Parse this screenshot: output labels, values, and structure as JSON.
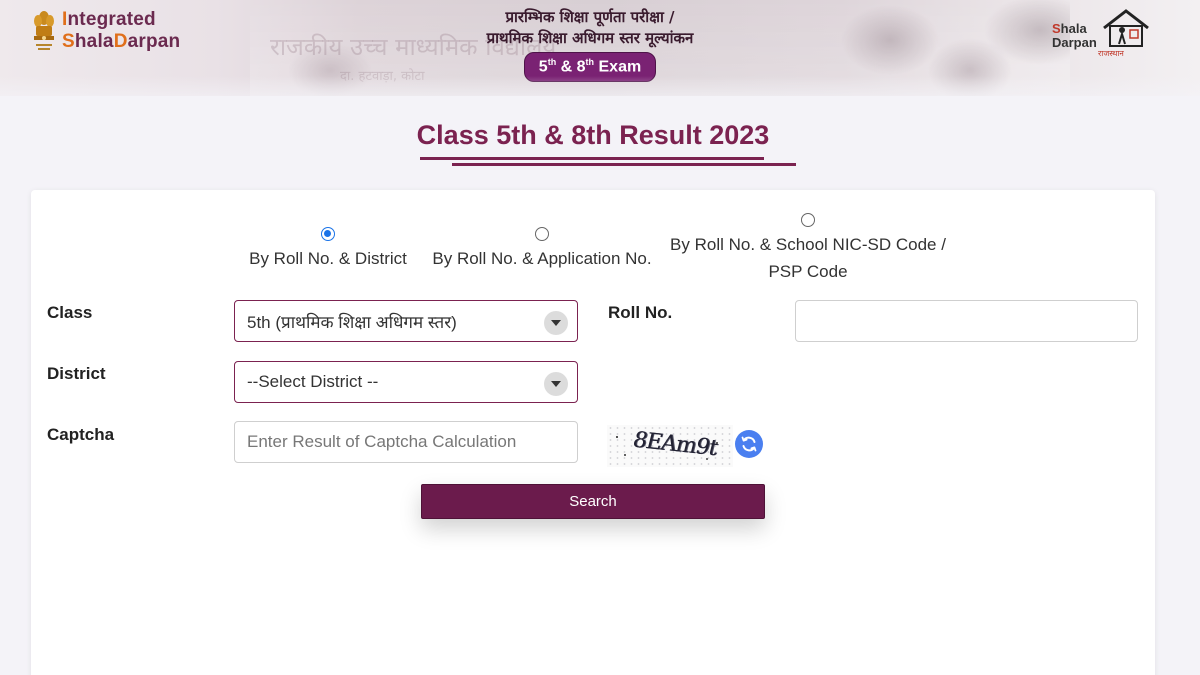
{
  "header": {
    "logo_left": {
      "line1_accent": "I",
      "line1_rest": "ntegrated",
      "line2_accent": "S",
      "line2_mid": "hala",
      "line2_accent2": "D",
      "line2_rest": "arpan"
    },
    "hindi_line1": "प्रारम्भिक शिक्षा पूर्णता परीक्षा /",
    "hindi_line2": "प्राथमिक शिक्षा अधिगम स्तर मूल्यांकन",
    "exam_pill": {
      "n1": "5",
      "sup1": "th",
      "mid": " & 8",
      "sup2": "th",
      "rest": " Exam"
    },
    "logo_right": {
      "line1_accent": "S",
      "line1_rest": "hala",
      "line2": "Darpan",
      "tag": "राजस्थान"
    },
    "background_ghost_text": "राजकीय उच्च माध्यमिक विद्यालय",
    "background_ghost_text2": "दा. हटवाड़ा, कोटा"
  },
  "heading": "Class 5th & 8th Result 2023",
  "search_modes": [
    {
      "label": "By Roll No. & District",
      "selected": true
    },
    {
      "label": "By Roll No. & Application No.",
      "selected": false
    },
    {
      "label_line1": "By Roll No. & School NIC-SD Code /",
      "label_line2": "PSP Code",
      "selected": false
    }
  ],
  "form": {
    "class_label": "Class",
    "class_value": "5th (प्राथमिक शिक्षा अधिगम स्तर)",
    "roll_label": "Roll No.",
    "roll_value": "",
    "district_label": "District",
    "district_value": "--Select District --",
    "captcha_label": "Captcha",
    "captcha_placeholder": "Enter Result of Captcha Calculation",
    "captcha_code": "8EAm9t",
    "search_label": "Search"
  },
  "colors": {
    "brand": "#7b2250",
    "button": "#6b1b4c",
    "radio_selected": "#1a73e8",
    "refresh": "#4a7ff0",
    "pill": "#7a2273"
  }
}
